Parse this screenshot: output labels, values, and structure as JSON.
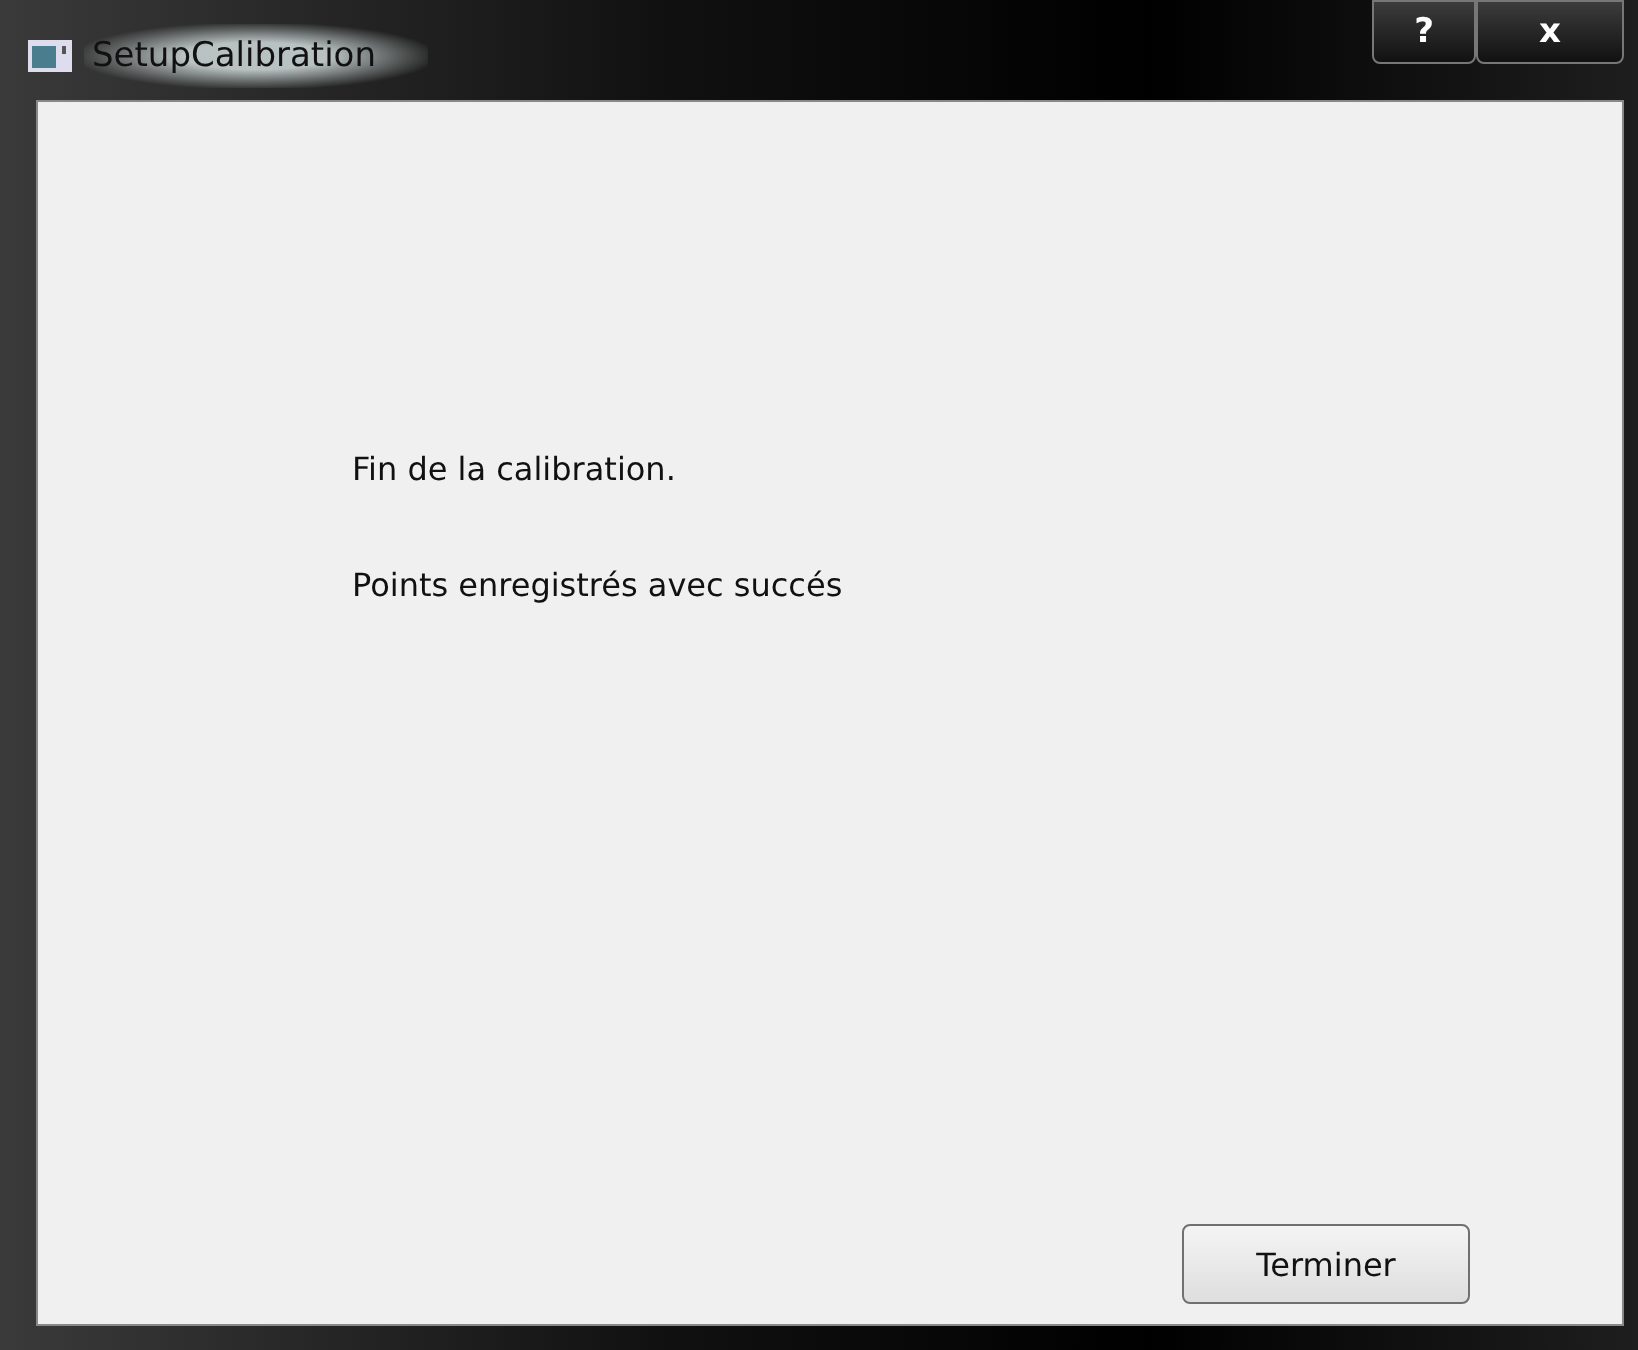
{
  "window": {
    "title": "SetupCalibration",
    "buttons": [
      "?",
      "x"
    ]
  },
  "messages": [
    "Fin de la calibration.",
    "Points enregistrés avec succés"
  ],
  "button": "Terminer"
}
